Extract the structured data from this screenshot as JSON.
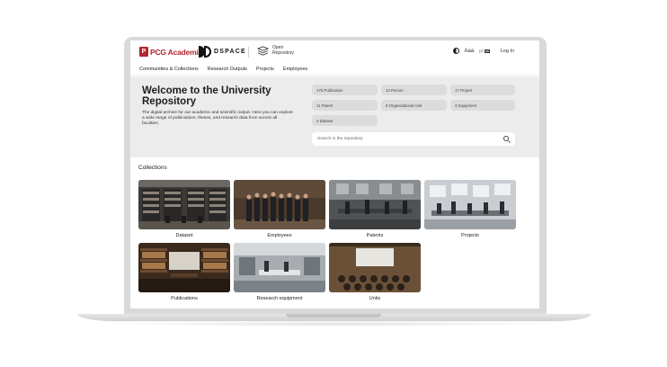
{
  "header": {
    "pcg_logo_text": "PCG Academia",
    "pcg_logo_mark": "P",
    "dspace_logo_text": "DSPACE",
    "open_repo_line1": "Open",
    "open_repo_line2": "Repository",
    "accessibility_label": "Aaa",
    "language_label": "pl",
    "login_label": "Log In"
  },
  "nav": {
    "items": [
      {
        "label": "Communities & Collections"
      },
      {
        "label": "Research Outputs"
      },
      {
        "label": "Projects"
      },
      {
        "label": "Employees"
      }
    ]
  },
  "hero": {
    "title": "Welcome to the University Repository",
    "description": "The digital archive for our academic and scientific output. Here you can explore a wide range of publications, theses, and research data from across all faculties.",
    "stats": [
      {
        "label": "170 Publication"
      },
      {
        "label": "13 Person"
      },
      {
        "label": "17 Project"
      },
      {
        "label": "11 Patent"
      },
      {
        "label": "9 Organizational Unit"
      },
      {
        "label": "3 Equipment"
      },
      {
        "label": "4 Dataset"
      }
    ],
    "search_placeholder": "Search in the repository"
  },
  "collections": {
    "title": "Collections",
    "items": [
      {
        "label": "Dataset",
        "icon": "library-photo"
      },
      {
        "label": "Employees",
        "icon": "group-photo"
      },
      {
        "label": "Patents",
        "icon": "workshop-photo"
      },
      {
        "label": "Projects",
        "icon": "meeting-photo"
      },
      {
        "label": "Publications",
        "icon": "bookshelf-photo"
      },
      {
        "label": "Research equipment",
        "icon": "lab-photo"
      },
      {
        "label": "Units",
        "icon": "lecture-photo"
      }
    ]
  },
  "colors": {
    "brand_red": "#b3262e",
    "hero_bg": "#ececec",
    "pill_bg": "#dcdcdc"
  }
}
